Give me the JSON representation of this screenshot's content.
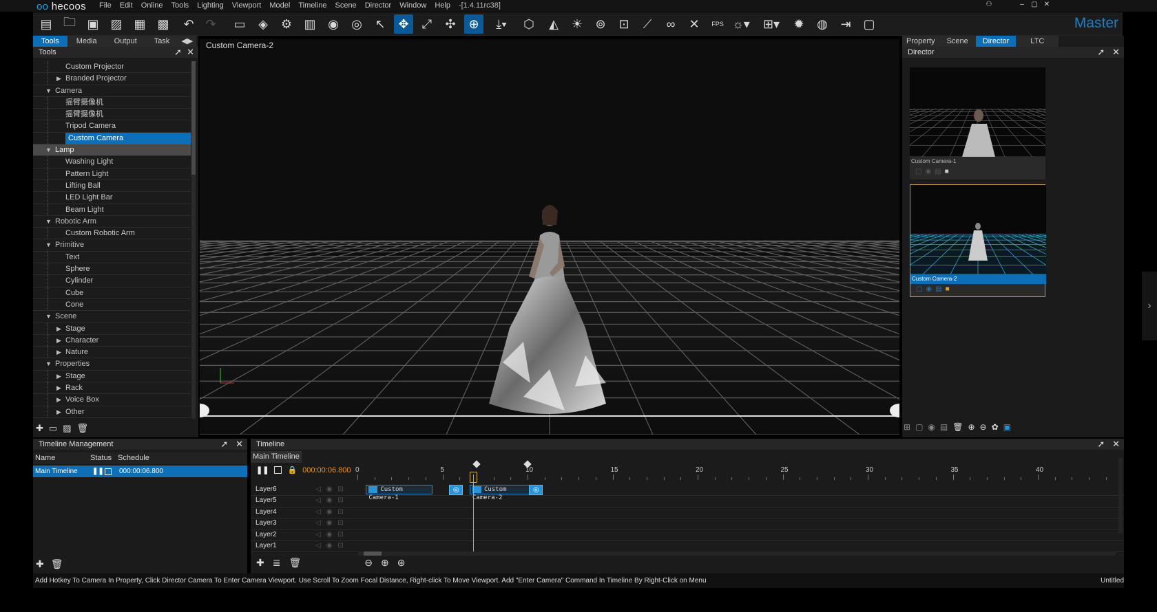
{
  "app": {
    "brand": "hecoos",
    "version": "-[1.4.11rc38]",
    "mode_label": "Master",
    "menu": [
      "File",
      "Edit",
      "Online",
      "Tools",
      "Lighting",
      "Viewport",
      "Model",
      "Timeline",
      "Scene",
      "Director",
      "Window",
      "Help"
    ],
    "accent_color": "#0d6fb8",
    "highlight_color": "#e3942a"
  },
  "left_tabs": [
    "Tools",
    "Media",
    "Output",
    "Task"
  ],
  "left_panel": {
    "title": "Tools",
    "tree": [
      {
        "label": "Custom Projector",
        "kind": "leaf"
      },
      {
        "label": "Branded Projector",
        "kind": "group"
      },
      {
        "label": "Camera",
        "kind": "cat"
      },
      {
        "label": "摇臂摄像机",
        "kind": "leaf"
      },
      {
        "label": "摇臂摄像机",
        "kind": "leaf"
      },
      {
        "label": "Tripod Camera",
        "kind": "leaf"
      },
      {
        "label": "Custom Camera",
        "kind": "leaf",
        "selected": true
      },
      {
        "label": "Lamp",
        "kind": "cat",
        "selected": true
      },
      {
        "label": "Washing Light",
        "kind": "leaf"
      },
      {
        "label": "Pattern Light",
        "kind": "leaf"
      },
      {
        "label": "Lifting Ball",
        "kind": "leaf"
      },
      {
        "label": "LED Light Bar",
        "kind": "leaf"
      },
      {
        "label": "Beam Light",
        "kind": "leaf"
      },
      {
        "label": "Robotic Arm",
        "kind": "cat"
      },
      {
        "label": "Custom Robotic Arm",
        "kind": "leaf"
      },
      {
        "label": "Primitive",
        "kind": "cat"
      },
      {
        "label": "Text",
        "kind": "leaf"
      },
      {
        "label": "Sphere",
        "kind": "leaf"
      },
      {
        "label": "Cylinder",
        "kind": "leaf"
      },
      {
        "label": "Cube",
        "kind": "leaf"
      },
      {
        "label": "Cone",
        "kind": "leaf"
      },
      {
        "label": "Scene",
        "kind": "cat"
      },
      {
        "label": "Stage",
        "kind": "group"
      },
      {
        "label": "Character",
        "kind": "group"
      },
      {
        "label": "Nature",
        "kind": "group"
      },
      {
        "label": "Properties",
        "kind": "cat"
      },
      {
        "label": "Stage",
        "kind": "group"
      },
      {
        "label": "Rack",
        "kind": "group"
      },
      {
        "label": "Voice Box",
        "kind": "group"
      },
      {
        "label": "Other",
        "kind": "group"
      }
    ]
  },
  "viewport": {
    "title": "Custom  Camera-2"
  },
  "right_tabs": [
    "Property",
    "Scene",
    "Director",
    "LTC"
  ],
  "right_panel": {
    "title": "Director",
    "cameras": [
      {
        "label": "Custom Camera-1",
        "selected": false
      },
      {
        "label": "Custom Camera-2",
        "selected": true
      }
    ]
  },
  "timeline_mgmt": {
    "title": "Timeline Management",
    "columns": [
      "Name",
      "Status",
      "Schedule"
    ],
    "rows": [
      {
        "name": "Main Timeline",
        "time": "000:00:06.800"
      }
    ]
  },
  "timeline": {
    "title": "Timeline",
    "tab": "Main Timeline",
    "time": "000:00:06.800",
    "ruler_labels": [
      "0",
      "5",
      "10",
      "15",
      "20",
      "25",
      "30",
      "35",
      "40"
    ],
    "playhead_seconds": 6.8,
    "keyframe_seconds": [
      7,
      10
    ],
    "layers": [
      "Layer6",
      "Layer5",
      "Layer4",
      "Layer3",
      "Layer2",
      "Layer1"
    ],
    "clips": [
      {
        "label": "Custom Camera-1",
        "start": 0.5,
        "end": 4.4
      },
      {
        "label": "Custom Camera-2",
        "start": 6.6,
        "end": 10.3
      }
    ],
    "cues": [
      5.8,
      10.5
    ]
  },
  "status": {
    "message": "Add Hotkey To Camera In Property, Click Director Camera To Enter Camera Viewport. Use Scroll To Zoom Focal Distance, Right-click To Move Viewport. Add \"Enter Camera\" Command In Timeline By Right-Click on Menu",
    "project": "Untitled"
  }
}
